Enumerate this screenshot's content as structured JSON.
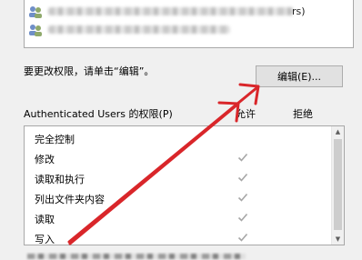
{
  "principals": {
    "row1_tail": "rs)"
  },
  "edit_note": "要更改权限，请单击“编辑”。",
  "edit_button": "编辑(E)...",
  "permissions": {
    "header": "Authenticated Users 的权限(P)",
    "allow_header": "允许",
    "deny_header": "拒绝",
    "items": [
      {
        "label": "完全控制",
        "allow": false
      },
      {
        "label": "修改",
        "allow": true
      },
      {
        "label": "读取和执行",
        "allow": true
      },
      {
        "label": "列出文件夹内容",
        "allow": true
      },
      {
        "label": "读取",
        "allow": true
      },
      {
        "label": "写入",
        "allow": true
      }
    ]
  },
  "colors": {
    "annotation_arrow": "#d9262a",
    "check_gray": "#a6a6a6"
  },
  "icons": [
    "user-group-icon",
    "check-icon",
    "scroll-up-icon",
    "scroll-down-icon"
  ]
}
